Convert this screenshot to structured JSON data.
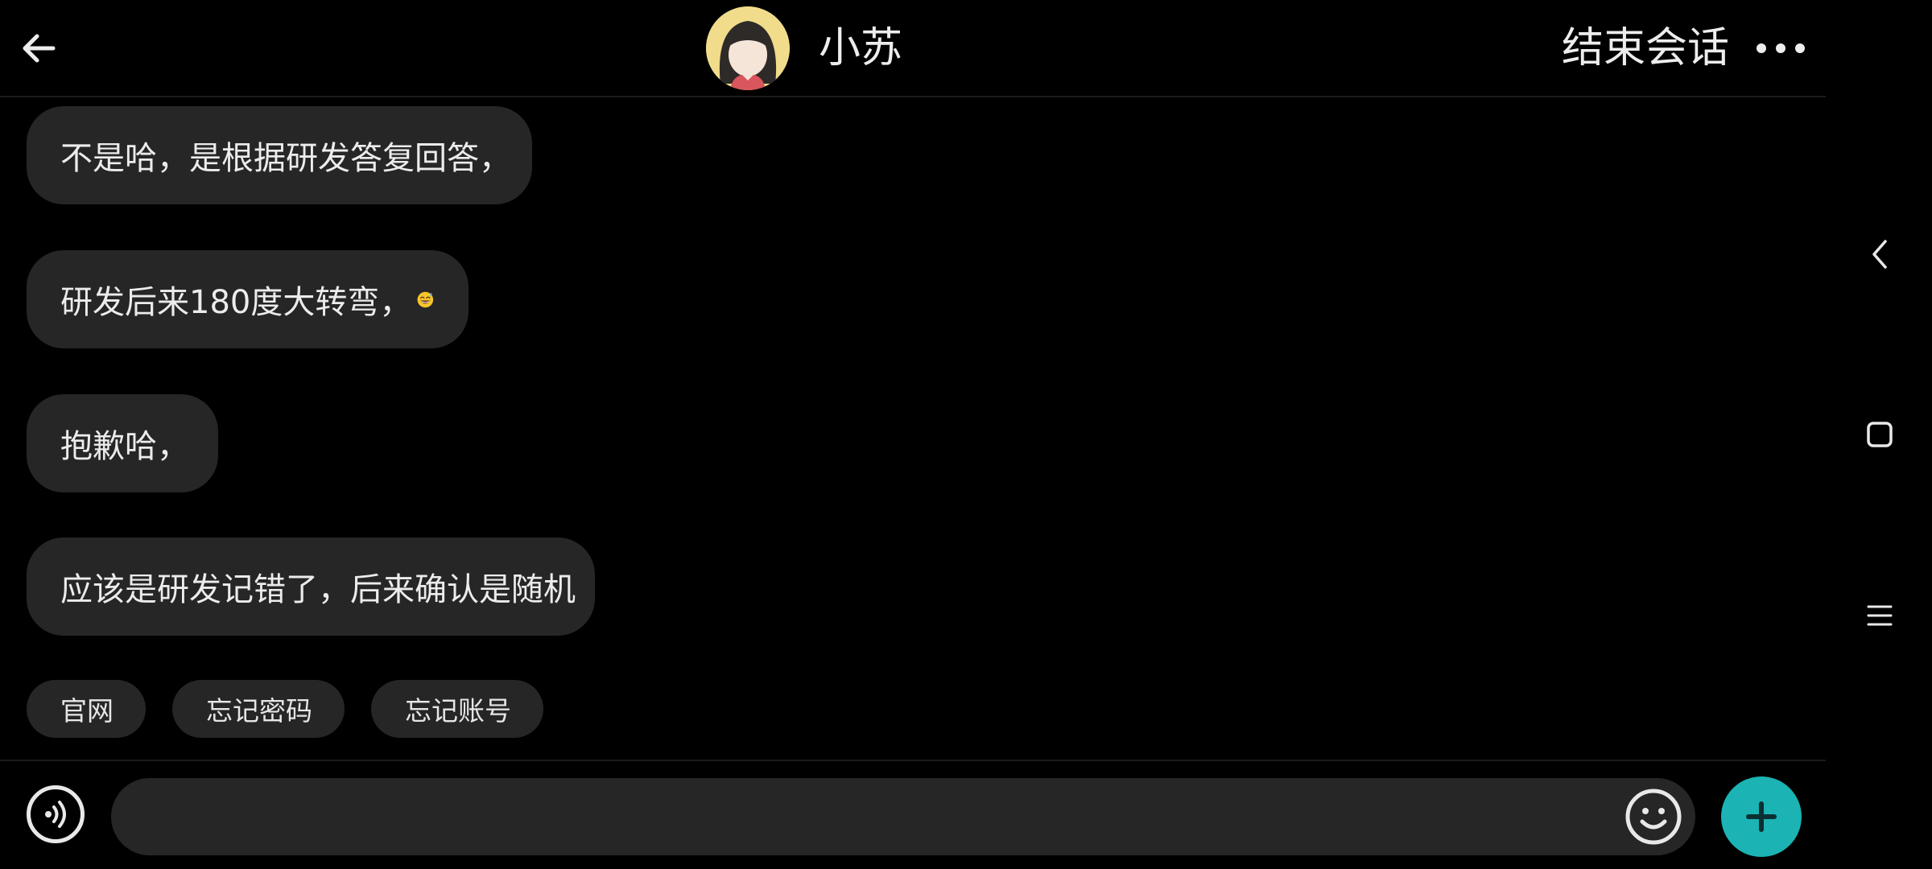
{
  "header": {
    "contact_name": "小苏",
    "end_session_label": "结束会话"
  },
  "messages": [
    {
      "text": "不是哈，是根据研发答复回答，"
    },
    {
      "text": "研发后来180度大转弯，",
      "emoji": "grinning-sweat-emoji"
    },
    {
      "text": "抱歉哈，"
    },
    {
      "text": "应该是研发记错了，后来确认是随机"
    }
  ],
  "quick_replies": [
    "官网",
    "忘记密码",
    "忘记账号"
  ],
  "input": {
    "value": "",
    "placeholder": ""
  },
  "colors": {
    "background": "#000000",
    "bubble": "#262626",
    "accent": "#1bb3b3",
    "avatar_bg": "#f0dc8a"
  },
  "icons": {
    "back": "arrow-left-icon",
    "more": "more-dots-icon",
    "voice": "voice-icon",
    "emoji": "smiley-icon",
    "plus": "plus-icon",
    "nav_back": "nav-back-icon",
    "nav_home": "nav-home-icon",
    "nav_recent": "nav-recent-icon"
  }
}
